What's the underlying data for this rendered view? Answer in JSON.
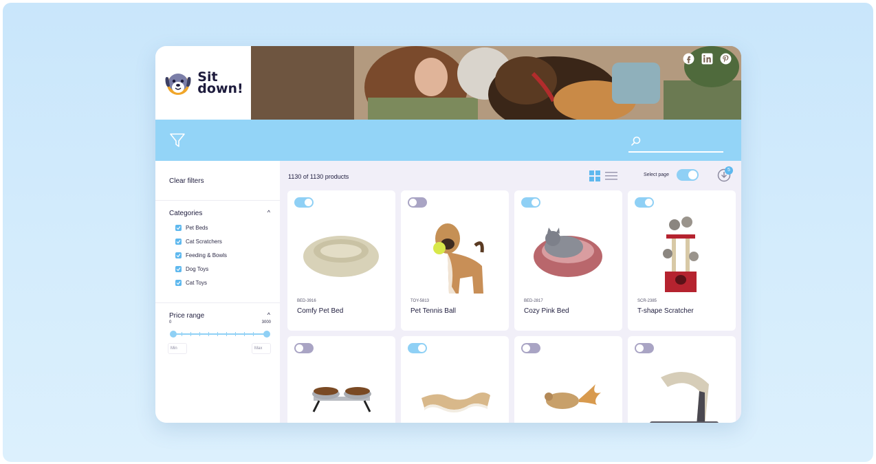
{
  "brand": {
    "name_line1": "Sit",
    "name_line2": "down!"
  },
  "social": [
    "facebook-icon",
    "linkedin-icon",
    "pinterest-icon"
  ],
  "search": {
    "value": "",
    "placeholder": ""
  },
  "sidebar": {
    "clear_filters": "Clear filters",
    "categories_title": "Categories",
    "categories": [
      {
        "label": "Pet Beds",
        "checked": true
      },
      {
        "label": "Cat Scratchers",
        "checked": true
      },
      {
        "label": "Feeding & Bowls",
        "checked": true
      },
      {
        "label": "Dog Toys",
        "checked": true
      },
      {
        "label": "Cat Toys",
        "checked": true
      }
    ],
    "price_title": "Price range",
    "price_min_label": "0",
    "price_max_label": "3000",
    "min_placeholder": "Min",
    "max_placeholder": "Max"
  },
  "main": {
    "count_text": "1130 of 1130 products",
    "select_page_label": "Select page",
    "select_page_on": true,
    "download_badge": "5"
  },
  "products": [
    {
      "sku": "BED-3916",
      "name": "Comfy Pet Bed",
      "selected": true,
      "image": "round-pet-bed"
    },
    {
      "sku": "TOY-5813",
      "name": "Pet Tennis Ball",
      "selected": false,
      "image": "dog-with-ball"
    },
    {
      "sku": "BED-2817",
      "name": "Cozy Pink Bed",
      "selected": true,
      "image": "cat-in-pink-bed"
    },
    {
      "sku": "SCR-2385",
      "name": "T-shape Scratcher",
      "selected": true,
      "image": "cat-tree"
    },
    {
      "sku": "",
      "name": "",
      "selected": false,
      "image": "double-food-bowls"
    },
    {
      "sku": "",
      "name": "",
      "selected": true,
      "image": "wave-scratcher"
    },
    {
      "sku": "",
      "name": "",
      "selected": false,
      "image": "mouse-toy"
    },
    {
      "sku": "",
      "name": "",
      "selected": false,
      "image": "curved-scratcher"
    }
  ],
  "colors": {
    "accent": "#93d4f7",
    "toggle_on": "#8fd0f5",
    "toggle_off": "#a9a4c4",
    "text": "#1d1b3c"
  }
}
